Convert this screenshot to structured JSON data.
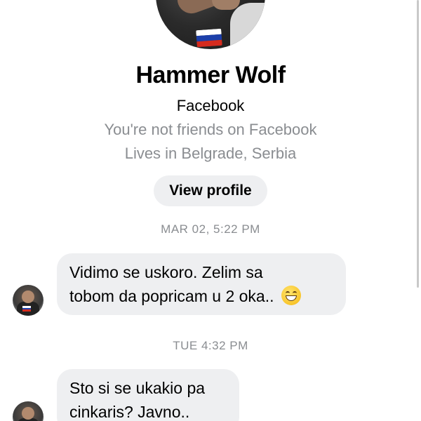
{
  "profile": {
    "name": "Hammer Wolf",
    "platform": "Facebook",
    "friendship_status": "You're not friends on Facebook",
    "location": "Lives in Belgrade, Serbia",
    "view_profile_label": "View profile",
    "flag_colors": [
      "#ffffff",
      "#1c3faa",
      "#d52b1e"
    ]
  },
  "conversation": {
    "groups": [
      {
        "timestamp": "MAR 02, 5:22 PM",
        "message_lines": [
          "Vidimo se uskoro. Zelim sa",
          "tobom da popricam u 2 oka.."
        ],
        "emoji": "grinning-face-with-smiling-eyes"
      },
      {
        "timestamp": "TUE 4:32 PM",
        "message_lines": [
          "Sto si se ukakio pa",
          "cinkaris? Javno.."
        ]
      }
    ]
  },
  "colors": {
    "bubble_bg": "#eeeff1",
    "muted_text": "#8a8d91",
    "button_bg": "#eeeff1"
  }
}
